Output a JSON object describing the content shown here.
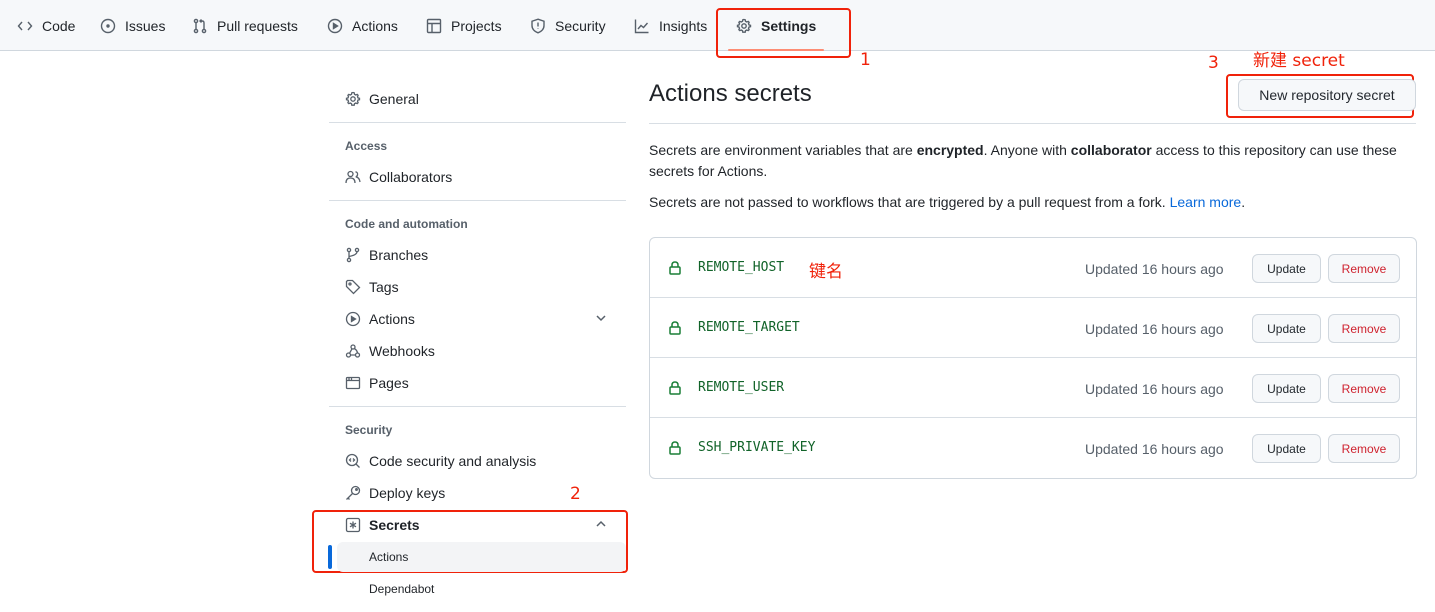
{
  "topnav": {
    "tabs": [
      {
        "label": "Code",
        "icon": "code-icon"
      },
      {
        "label": "Issues",
        "icon": "issue-opened-icon"
      },
      {
        "label": "Pull requests",
        "icon": "git-pull-request-icon"
      },
      {
        "label": "Actions",
        "icon": "play-icon"
      },
      {
        "label": "Projects",
        "icon": "table-icon"
      },
      {
        "label": "Security",
        "icon": "shield-icon"
      },
      {
        "label": "Insights",
        "icon": "graph-icon"
      },
      {
        "label": "Settings",
        "icon": "gear-icon",
        "active": true
      }
    ]
  },
  "annotations": {
    "step1": "1",
    "step2": "2",
    "step3": "3",
    "new_secret_note": "新建 secret",
    "key_name_note": "键名",
    "color": "#f0220a"
  },
  "sidebar": {
    "general": "General",
    "access_heading": "Access",
    "collaborators": "Collaborators",
    "code_heading": "Code and automation",
    "branches": "Branches",
    "tags": "Tags",
    "actions": "Actions",
    "webhooks": "Webhooks",
    "pages": "Pages",
    "security_heading": "Security",
    "code_security": "Code security and analysis",
    "deploy_keys": "Deploy keys",
    "secrets": "Secrets",
    "secrets_sub": [
      {
        "label": "Actions",
        "selected": true
      },
      {
        "label": "Dependabot",
        "selected": false
      }
    ]
  },
  "main": {
    "title": "Actions secrets",
    "new_button": "New repository secret",
    "para1_a": "Secrets are environment variables that are ",
    "para1_b": "encrypted",
    "para1_c": ". Anyone with ",
    "para1_d": "collaborator",
    "para1_e": " access to this repository can use these secrets for Actions.",
    "para2_a": "Secrets are not passed to workflows that are triggered by a pull request from a fork. ",
    "para2_link": "Learn more",
    "para2_end": ".",
    "secrets": [
      {
        "name": "REMOTE_HOST",
        "updated": "Updated 16 hours ago",
        "update_label": "Update",
        "remove_label": "Remove"
      },
      {
        "name": "REMOTE_TARGET",
        "updated": "Updated 16 hours ago",
        "update_label": "Update",
        "remove_label": "Remove"
      },
      {
        "name": "REMOTE_USER",
        "updated": "Updated 16 hours ago",
        "update_label": "Update",
        "remove_label": "Remove"
      },
      {
        "name": "SSH_PRIVATE_KEY",
        "updated": "Updated 16 hours ago",
        "update_label": "Update",
        "remove_label": "Remove"
      }
    ],
    "accent_color": "#0969da",
    "danger_color": "#cf222e",
    "secret_color": "#116329"
  }
}
